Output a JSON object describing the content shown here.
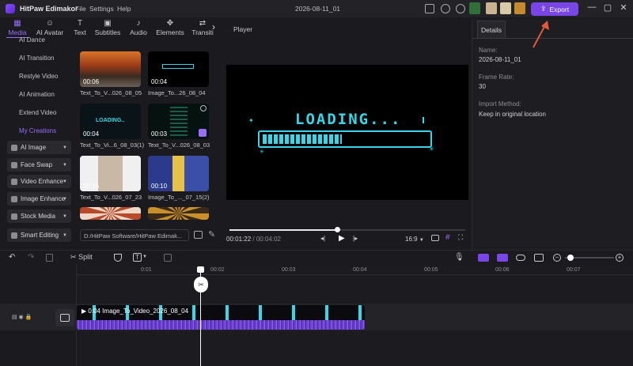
{
  "titlebar": {
    "app_name": "HitPaw Edimakor",
    "menu": [
      "File",
      "Settings",
      "Help"
    ],
    "project_name": "2026-08-11_01",
    "export_label": "Export"
  },
  "tabs": [
    {
      "label": "Media",
      "icon": "media-icon",
      "active": true
    },
    {
      "label": "AI Avatar",
      "icon": "ai-avatar-icon"
    },
    {
      "label": "Text",
      "icon": "text-icon"
    },
    {
      "label": "Subtitles",
      "icon": "subtitles-icon"
    },
    {
      "label": "Audio",
      "icon": "audio-icon"
    },
    {
      "label": "Elements",
      "icon": "elements-icon"
    },
    {
      "label": "Transiti",
      "icon": "transition-icon"
    }
  ],
  "left_nav": {
    "text_items": [
      "AI Dance",
      "AI Transition",
      "Restyle Video",
      "AI Animation",
      "Extend Video",
      "My Creations"
    ],
    "active_item": "My Creations",
    "dropdowns": [
      "AI Image",
      "Face Swap",
      "Video Enhance",
      "Image Enhance",
      "Stock Media",
      "Smart Editing"
    ]
  },
  "media": {
    "items": [
      {
        "duration": "00:06",
        "caption": "Text_To_V...026_08_05"
      },
      {
        "duration": "00:04",
        "caption": "Image_To...26_08_04"
      },
      {
        "duration": "00:04",
        "caption": "Text_To_Vi...6_08_03(1)"
      },
      {
        "duration": "00:03",
        "caption": "Text_To_V...026_08_03"
      },
      {
        "duration": "00:15",
        "caption": "Text_To_V...026_07_23"
      },
      {
        "duration": "00:10",
        "caption": "Image_To_..._07_15(2)"
      }
    ],
    "path": "D:/HitPaw Software/HitPaw Edimak..."
  },
  "player": {
    "title": "Player",
    "loading_text": "LOADING...",
    "current_time": "00:01:22",
    "total_time": "00:04:02",
    "aspect": "16:9",
    "progress": 0.455
  },
  "details": {
    "tab": "Details",
    "name_label": "Name:",
    "name_value": "2026-08-11_01",
    "frame_rate_label": "Frame Rate:",
    "frame_rate_value": "30",
    "import_label": "Import Method:",
    "import_value": "Keep in original location"
  },
  "toolbar": {
    "split_label": "Split",
    "zoom_level": 0.12
  },
  "timeline": {
    "ruler": [
      "0:01",
      "00:02",
      "00:03",
      "00:04",
      "00:05",
      "00:06",
      "00:07"
    ],
    "clip_label": "0:04  Image_To_Video_2026_08_04"
  },
  "colors": {
    "accent": "#7a45e6",
    "export_bg": "#7a45e6",
    "loading_cyan": "#39d6e8"
  }
}
